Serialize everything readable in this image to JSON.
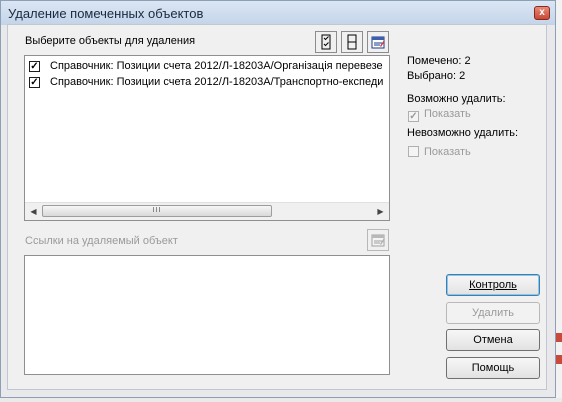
{
  "window": {
    "title": "Удаление помеченных объектов",
    "close_glyph": "x"
  },
  "select_section": {
    "label": "Выберите объекты для удаления",
    "items": [
      {
        "checked": true,
        "text": "Справочник: Позиции счета  2012/Л-18203А/Організація перевезе"
      },
      {
        "checked": true,
        "text": "Справочник: Позиции счета  2012/Л-18203А/Транспортно-експеди"
      }
    ],
    "scroll_grip": "III"
  },
  "refs_section": {
    "label": "Ссылки на удаляемый объект"
  },
  "info": {
    "marked": "Помечено: 2",
    "selected": "Выбрано: 2",
    "can_delete_label": "Возможно удалить:",
    "can_delete_show": "Показать",
    "cannot_delete_label": "Невозможно удалить:",
    "cannot_delete_show": "Показать"
  },
  "buttons": {
    "control": "Контроль",
    "delete": "Удалить",
    "cancel": "Отмена",
    "help": "Помощь"
  },
  "checkbox_glyph": "✓"
}
